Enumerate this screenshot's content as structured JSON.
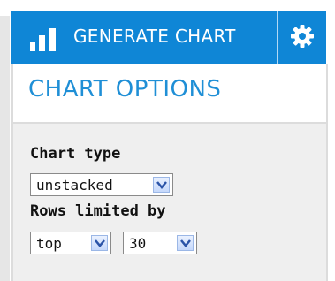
{
  "toolbar": {
    "generate_label": "GENERATE CHART",
    "generate_icon": "bar-chart-icon",
    "settings_icon": "gear-icon",
    "accent_color": "#0f86d6"
  },
  "options": {
    "title": "CHART OPTIONS",
    "chart_type_label": "Chart type",
    "chart_type_value": "unstacked",
    "rows_limited_label": "Rows limited by",
    "rows_limit_mode": "top",
    "rows_limit_count": "30"
  }
}
